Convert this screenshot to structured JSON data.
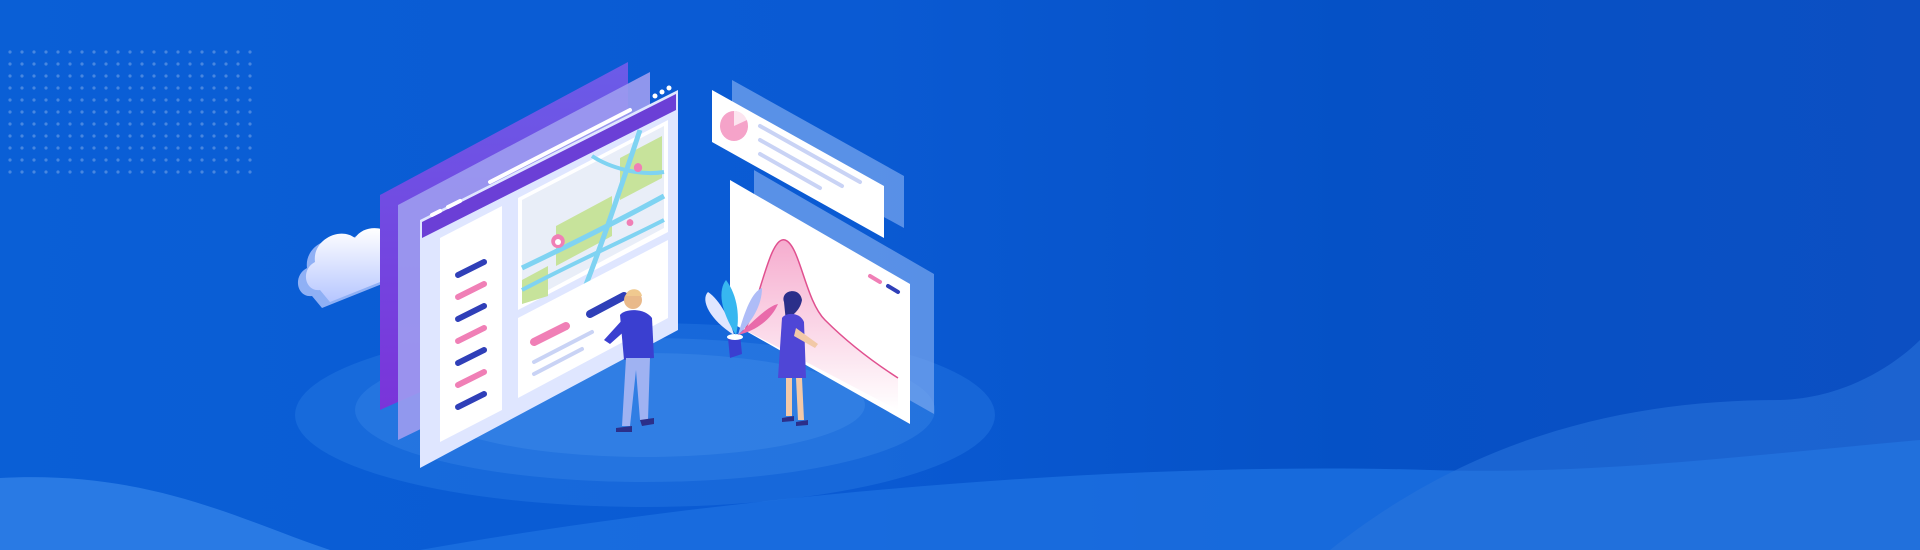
{
  "banner": {
    "colors": {
      "bg_left": "#0a60d8",
      "bg_right": "#0851c7",
      "wave_light": "#2a7de6",
      "wave_mid": "#1b6fdf",
      "panel_purple": "#6a3fe0",
      "panel_white": "#ffffff",
      "accent_pink": "#f07fb6",
      "accent_navy": "#2f3fb8",
      "map_green": "#c7e39b",
      "map_road": "#7fd3f2"
    },
    "icons": {
      "cloud": "cloud-icon",
      "map_pin": "map-pin-icon",
      "pie": "pie-chart-icon"
    }
  }
}
